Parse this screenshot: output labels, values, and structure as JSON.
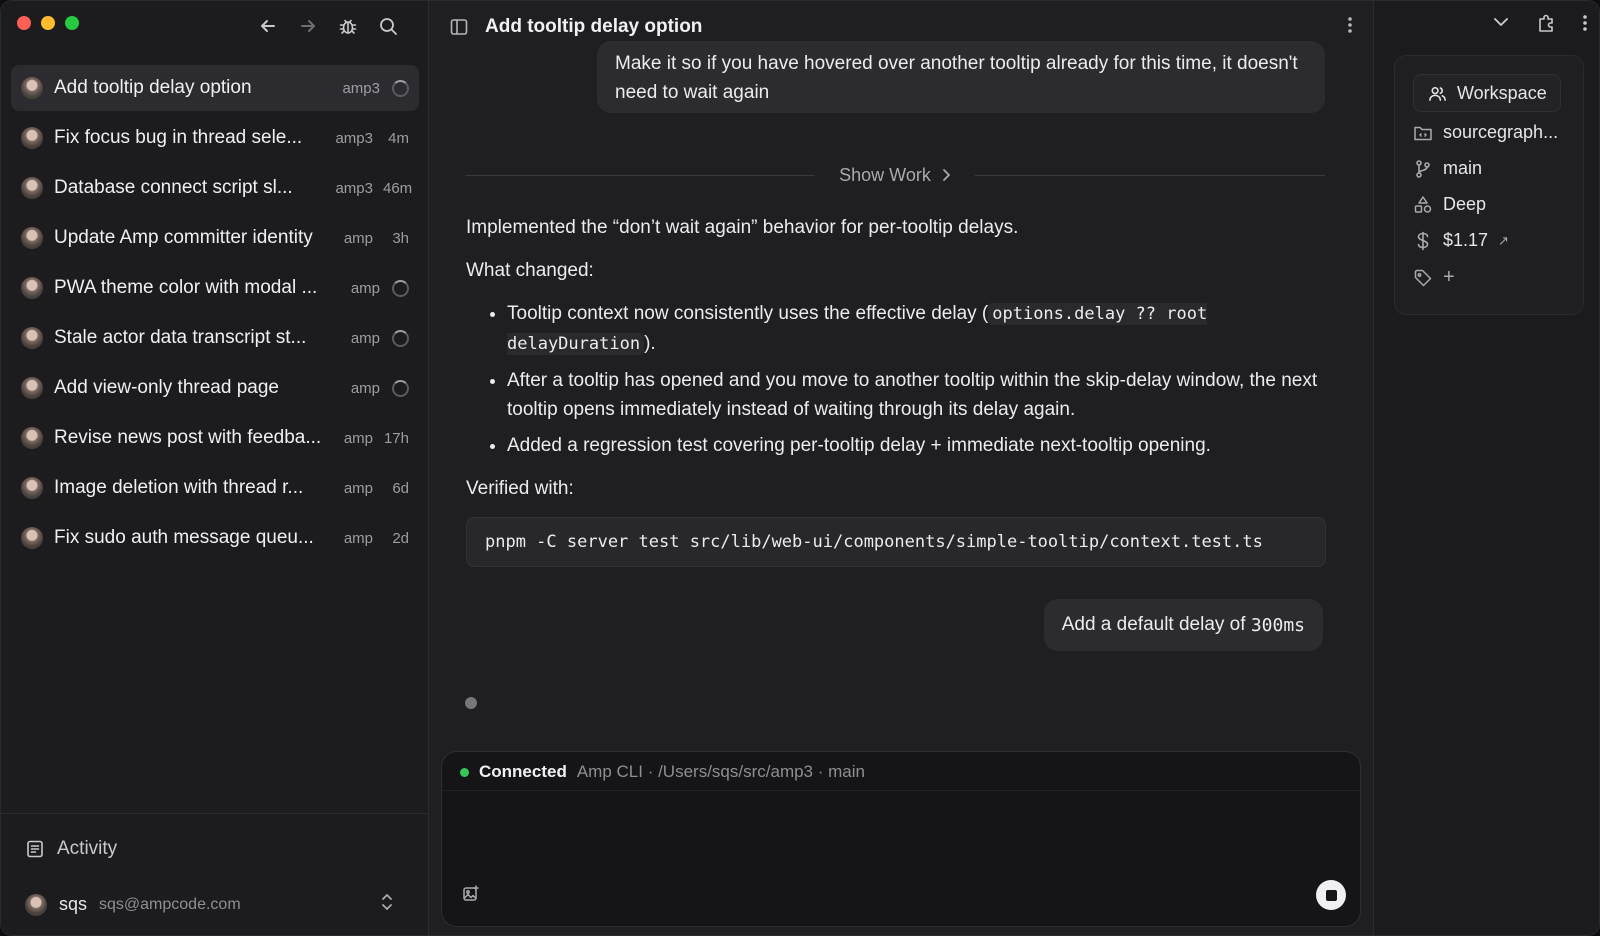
{
  "window": {
    "traffic_lights": {
      "close_color": "#fe5f57",
      "minimize_color": "#febc2e",
      "maximize_color": "#28c840"
    }
  },
  "sidebar": {
    "threads": [
      {
        "title": "Add tooltip delay option",
        "tag": "amp3",
        "meta": "",
        "loading": true,
        "active": true
      },
      {
        "title": "Fix focus bug in thread sele...",
        "tag": "amp3",
        "meta": "4m",
        "loading": false
      },
      {
        "title": "Database connect script sl...",
        "tag": "amp3",
        "meta": "46m",
        "loading": false
      },
      {
        "title": "Update Amp committer identity",
        "tag": "amp",
        "meta": "3h",
        "loading": false
      },
      {
        "title": "PWA theme color with modal ...",
        "tag": "amp",
        "meta": "",
        "loading": true
      },
      {
        "title": "Stale actor data transcript st...",
        "tag": "amp",
        "meta": "",
        "loading": true
      },
      {
        "title": "Add view-only thread page",
        "tag": "amp",
        "meta": "",
        "loading": true
      },
      {
        "title": "Revise news post with feedba...",
        "tag": "amp",
        "meta": "17h",
        "loading": false
      },
      {
        "title": "Image deletion with thread r...",
        "tag": "amp",
        "meta": "6d",
        "loading": false
      },
      {
        "title": "Fix sudo auth message queu...",
        "tag": "amp",
        "meta": "2d",
        "loading": false
      }
    ],
    "activity_label": "Activity",
    "user": {
      "name": "sqs",
      "email": "sqs@ampcode.com"
    }
  },
  "main": {
    "title": "Add tooltip delay option",
    "prev_user_message": "Make it so if you have hovered over another tooltip already for this time, it doesn't need to wait again",
    "show_work_label": "Show Work",
    "response": {
      "intro": "Implemented the “don’t wait again” behavior for per-tooltip delays.",
      "what_changed_heading": "What changed:",
      "bullet1_pre": "Tooltip context now consistently uses the effective delay (",
      "bullet1_code": "options.delay ?? root delayDuration",
      "bullet1_post": ").",
      "bullet2": "After a tooltip has opened and you move to another tooltip within the skip-delay window, the next tooltip opens immediately instead of waiting through its delay again.",
      "bullet3": "Added a regression test covering per-tooltip delay + immediate next-tooltip opening.",
      "verified_heading": "Verified with:",
      "command": "pnpm -C server test src/lib/web-ui/components/simple-tooltip/context.test.ts"
    },
    "user_message_pre": "Add a default delay of ",
    "user_message_code": "300ms",
    "composer": {
      "status": "Connected",
      "status_color": "#34c759",
      "context": "Amp CLI · /Users/sqs/src/amp3 · main"
    }
  },
  "right_panel": {
    "workspace_label": "Workspace",
    "repo": "sourcegraph...",
    "branch": "main",
    "mode": "Deep",
    "cost": "$1.17",
    "tag_add": "+"
  }
}
